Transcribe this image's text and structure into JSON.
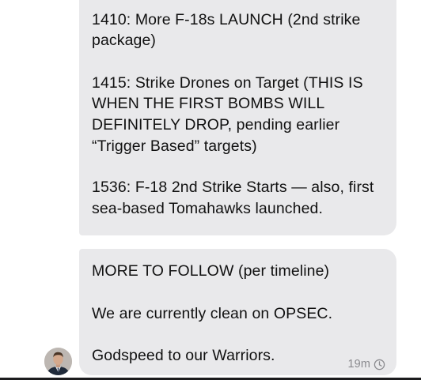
{
  "conversation": {
    "message_1": {
      "lines": [
        "(. . . . )",
        "1410: More F-18s LAUNCH (2nd strike",
        "package)",
        "1415: Strike Drones on Target (THIS IS",
        "WHEN THE FIRST BOMBS WILL",
        "DEFINITELY DROP, pending earlier",
        "“Trigger Based” targets)",
        "1536: F-18 2nd Strike Starts — also, first",
        "sea-based Tomahawks launched."
      ]
    },
    "message_2": {
      "lines": [
        "MORE TO FOLLOW (per timeline)",
        "We are currently clean on OPSEC.",
        "Godspeed to our Warriors."
      ],
      "timestamp": "19m",
      "status_icon": "clock-icon"
    },
    "sender": {
      "avatar_icon": "person-avatar"
    }
  },
  "colors": {
    "incoming_bubble": "#e9e9eb",
    "text": "#111111",
    "timestamp": "#8a8a8e",
    "background": "#ffffff"
  }
}
